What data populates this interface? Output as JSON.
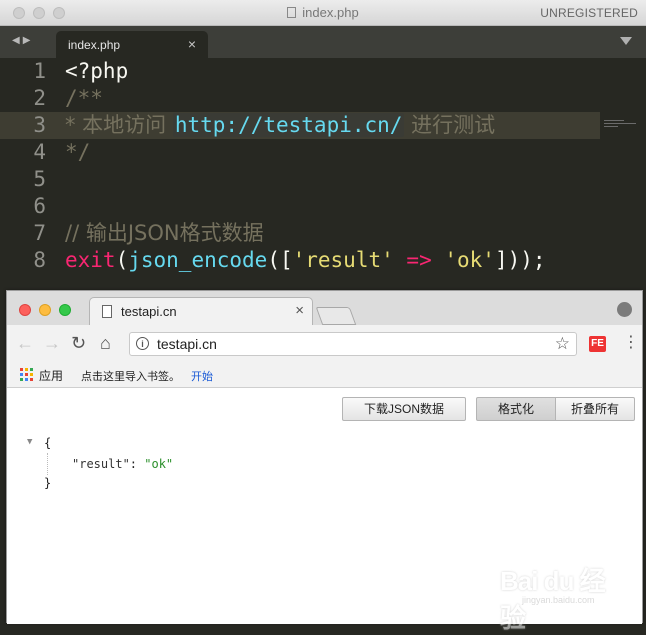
{
  "editor": {
    "title": "index.php",
    "registration": "UNREGISTERED",
    "tab": {
      "label": "index.php",
      "close": "×"
    },
    "lines": [
      {
        "number": "1",
        "text": "<?php"
      },
      {
        "number": "2",
        "text": "/**"
      },
      {
        "number": "3",
        "prefix": "* 本地访问 ",
        "url": "http://testapi.cn/",
        "suffix": " 进行测试"
      },
      {
        "number": "4",
        "text": "*/"
      },
      {
        "number": "5",
        "text": ""
      },
      {
        "number": "6",
        "text": ""
      },
      {
        "number": "7",
        "text": "// 输出JSON格式数据"
      },
      {
        "number": "8",
        "fn": "exit",
        "p1": "(",
        "builtin": "json_encode",
        "p2": "([",
        "key": "'result'",
        "op": "=>",
        "val": "'ok'",
        "p3": "]));"
      }
    ]
  },
  "browser": {
    "tab": {
      "title": "testapi.cn",
      "close": "×"
    },
    "address": "testapi.cn",
    "nav": {
      "back": "←",
      "forward": "→",
      "reload": "↻",
      "home": "⌂",
      "star": "☆",
      "menu": "⋮"
    },
    "extension_label": "FE",
    "bookmarks": {
      "apps": "应用",
      "hint": "点击这里导入书签。",
      "start": "开始"
    },
    "json_viewer": {
      "download_button": "下载JSON数据",
      "format_button": "格式化",
      "collapse_button": "折叠所有",
      "toggle": "▼",
      "open_brace": "{",
      "key": "\"result\"",
      "colon": ": ",
      "value": "\"ok\"",
      "close_brace": "}"
    }
  },
  "watermark": {
    "text": "Bai du 经验",
    "sub": "jingyan.baidu.com"
  },
  "colors": {
    "editor_bg": "#272822",
    "comment": "#75715e",
    "keyword": "#f92672",
    "builtin": "#66d9ef",
    "string": "#e6db74",
    "line_number": "#90908a"
  }
}
